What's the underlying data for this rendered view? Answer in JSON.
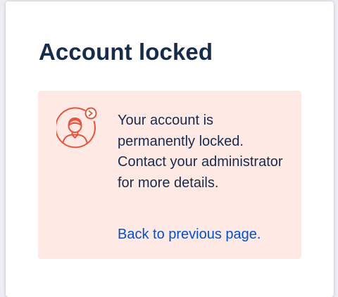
{
  "page": {
    "title": "Account locked"
  },
  "alert": {
    "icon": "locked-user-icon",
    "message": "Your account is permanently locked. Contact your administrator for more details.",
    "link_label": "Back to previous page."
  },
  "colors": {
    "title_text": "#172b4d",
    "alert_background": "#ffe9e5",
    "icon_accent": "#e5543d",
    "link": "#0052cc"
  }
}
